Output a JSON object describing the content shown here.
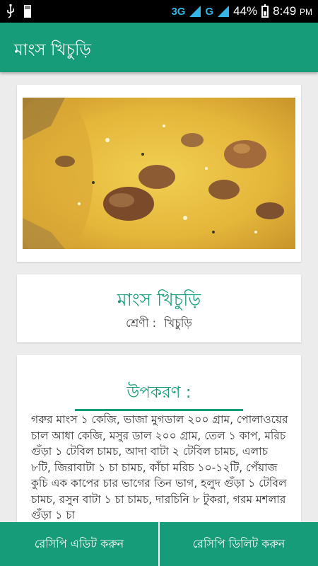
{
  "status_bar": {
    "network_type": "3G",
    "network_type_2": "G",
    "battery_percent": "44%",
    "time": "8:49",
    "time_suffix": "PM"
  },
  "app_bar": {
    "title": "মাংস খিচুড়ি"
  },
  "recipe": {
    "title": "মাংস খিচুড়ি",
    "category_label": "শ্রেণী :",
    "category_value": "খিচুড়ি"
  },
  "ingredients": {
    "heading": "উপকরণ :",
    "text": "গরুর মাংস ১ কেজি, ভাজা মুগডাল ২০০ গ্রাম, পোলাওয়ের চাল আধা কেজি, মসুর ডাল ২০০ গ্রাম, তেল ১ কাপ, মরিচ গুঁড়া ১ টেবিল চামচ, আদা বাটা ২ টেবিল চামচ, এলাচ ৮টি, জিরাবাটা ১ চা চামচ, কাঁচা মরিচ ১০-১২টি, পেঁয়াজ কুচি এক কাপের চার ভাগের তিন ভাগ, হলুদ গুঁড়া ১ টেবিল চামচ, রসুন বাটা ১ চা চামচ, দারচিনি ৮ টুকরা, গরম মশলার গুঁড়া ১ চা"
  },
  "actions": {
    "edit_label": "রেসিপি এডিট করুন",
    "delete_label": "রেসিপি ডিলিট করুন"
  },
  "colors": {
    "primary": "#169c78",
    "status_bar": "#000000",
    "background": "#ececec"
  },
  "icons": [
    "usb-icon",
    "sd-card-icon",
    "signal-icon",
    "battery-icon"
  ]
}
